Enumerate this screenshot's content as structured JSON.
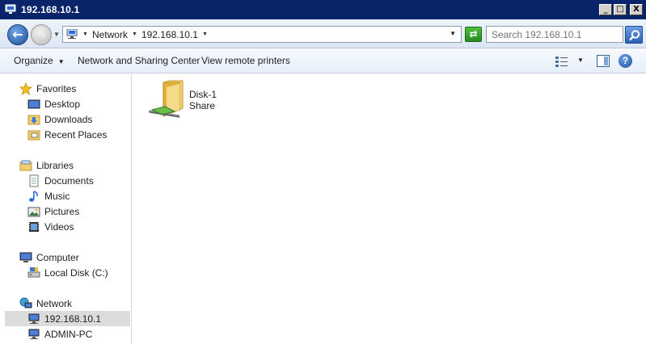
{
  "window": {
    "title": "192.168.10.1",
    "controls": [
      "_",
      "□",
      "X"
    ]
  },
  "address": {
    "crumbs": [
      "Network",
      "192.168.10.1"
    ],
    "search_placeholder": "Search 192.168.10.1"
  },
  "commandbar": {
    "organize": "Organize",
    "network_sharing": "Network and Sharing Center",
    "view_printers": "View remote printers"
  },
  "navpane": {
    "favorites": {
      "label": "Favorites",
      "items": [
        "Desktop",
        "Downloads",
        "Recent Places"
      ]
    },
    "libraries": {
      "label": "Libraries",
      "items": [
        "Documents",
        "Music",
        "Pictures",
        "Videos"
      ]
    },
    "computer": {
      "label": "Computer",
      "items": [
        "Local Disk (C:)"
      ]
    },
    "network": {
      "label": "Network",
      "items": [
        "192.168.10.1",
        "ADMIN-PC"
      ]
    }
  },
  "content": {
    "shares": [
      {
        "name": "Disk-1",
        "type": "Share"
      }
    ]
  },
  "icons": {
    "back": "arrow-left-icon",
    "forward": "arrow-right-icon",
    "refresh": "refresh-icon",
    "search": "search-icon",
    "help": "help-icon"
  },
  "colors": {
    "titlebar": "#0a246a",
    "selected_nav": "#dcdcdc",
    "accent": "#1d4f9c"
  }
}
